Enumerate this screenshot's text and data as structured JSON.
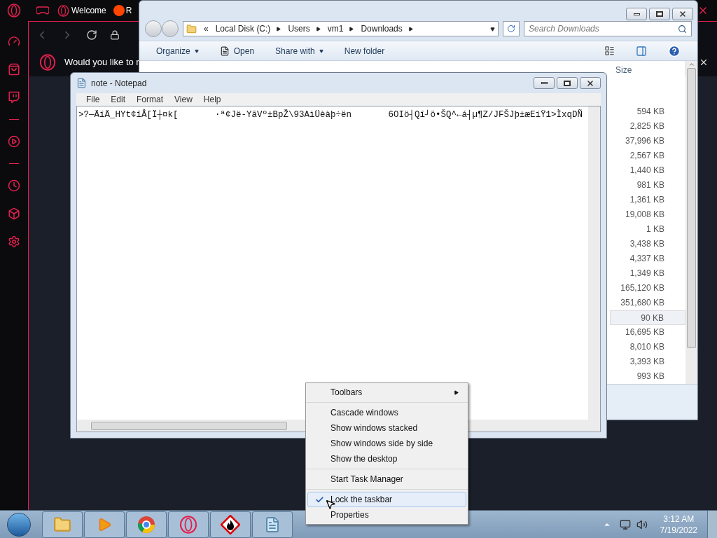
{
  "browser": {
    "tabs": [
      {
        "label": "Welcome"
      },
      {
        "label": "R"
      }
    ],
    "notification": "Would you like to r"
  },
  "explorer": {
    "overflow": "«",
    "breadcrumb": [
      "Local Disk (C:)",
      "Users",
      "vm1",
      "Downloads"
    ],
    "search": {
      "placeholder": "Search Downloads"
    },
    "toolbar": [
      {
        "label": "Organize",
        "kind": "dropdown"
      },
      {
        "label": "Open",
        "kind": "icon"
      },
      {
        "label": "Share with",
        "kind": "dropdown"
      },
      {
        "label": "New folder",
        "kind": "plain"
      }
    ],
    "columns": [
      "Size"
    ],
    "sizes": [
      {
        "value": "594 KB",
        "selected": false
      },
      {
        "value": "2,825 KB",
        "selected": false
      },
      {
        "value": "37,996 KB",
        "selected": false
      },
      {
        "value": "2,567 KB",
        "selected": false
      },
      {
        "value": "1,440 KB",
        "selected": false
      },
      {
        "value": "981 KB",
        "selected": false
      },
      {
        "value": "1,361 KB",
        "selected": false
      },
      {
        "value": "19,008 KB",
        "selected": false
      },
      {
        "value": "1 KB",
        "selected": false
      },
      {
        "value": "3,438 KB",
        "selected": false
      },
      {
        "value": "4,337 KB",
        "selected": false
      },
      {
        "value": "1,349 KB",
        "selected": false
      },
      {
        "value": "165,120 KB",
        "selected": false
      },
      {
        "value": "351,680 KB",
        "selected": false
      },
      {
        "value": "90 KB",
        "selected": true
      },
      {
        "value": "16,695 KB",
        "selected": false
      },
      {
        "value": "8,010 KB",
        "selected": false
      },
      {
        "value": "3,393 KB",
        "selected": false
      },
      {
        "value": "993 KB",
        "selected": false
      }
    ]
  },
  "notepad": {
    "title": "note - Notepad",
    "menu": [
      "File",
      "Edit",
      "Format",
      "View",
      "Help"
    ],
    "text": ">?—ÄíÄ_HYt¢îÂ[Ï┼¤k[       ·ª¢Jë-YãVº±BpŽ\\93AìÜèàþ÷ën       6OIö┤Qî┘ö•ŠQ^←á┤µ¶Z/JFŠJþ±æEíŸ1>ÌxqDÑ"
  },
  "context_menu": [
    [
      {
        "label": "Toolbars",
        "submenu": true,
        "checked": false,
        "highlighted": false
      }
    ],
    [
      {
        "label": "Cascade windows",
        "submenu": false,
        "checked": false,
        "highlighted": false
      },
      {
        "label": "Show windows stacked",
        "submenu": false,
        "checked": false,
        "highlighted": false
      },
      {
        "label": "Show windows side by side",
        "submenu": false,
        "checked": false,
        "highlighted": false
      },
      {
        "label": "Show the desktop",
        "submenu": false,
        "checked": false,
        "highlighted": false
      }
    ],
    [
      {
        "label": "Start Task Manager",
        "submenu": false,
        "checked": false,
        "highlighted": false
      }
    ],
    [
      {
        "label": "Lock the taskbar",
        "submenu": false,
        "checked": true,
        "highlighted": true
      },
      {
        "label": "Properties",
        "submenu": false,
        "checked": false,
        "highlighted": false
      }
    ]
  ],
  "taskbar": {
    "time": "3:12 AM",
    "date": "7/19/2022"
  }
}
